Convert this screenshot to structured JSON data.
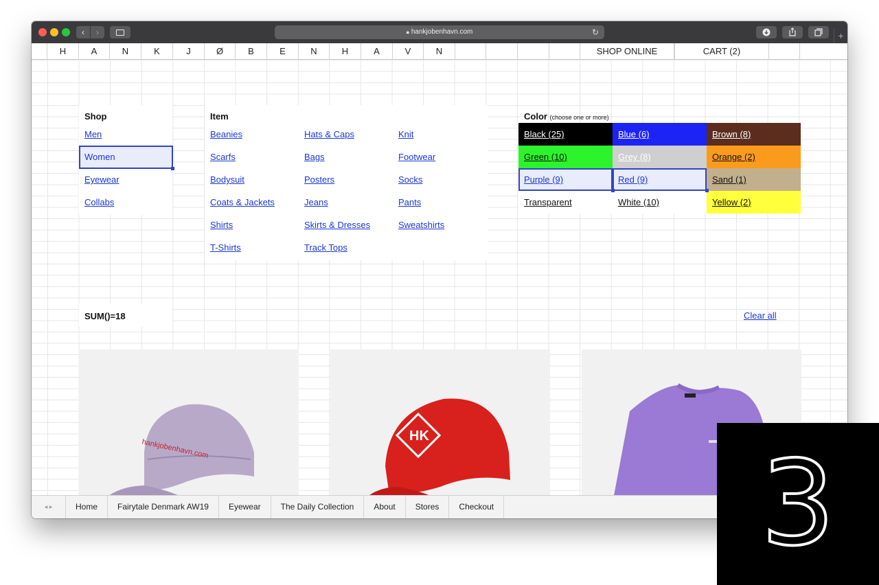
{
  "browser": {
    "url": "hankjobenhavn.com",
    "back_glyph": "‹",
    "forward_glyph": "›",
    "reload_glyph": "↻",
    "new_tab_glyph": "+",
    "icons": [
      "back-icon",
      "forward-icon",
      "sidebar-icon",
      "lock-icon",
      "reload-icon",
      "download-icon",
      "share-icon",
      "tabs-icon"
    ]
  },
  "header": {
    "columns": [
      "",
      "H",
      "A",
      "N",
      "K",
      "J",
      "Ø",
      "B",
      "E",
      "N",
      "H",
      "A",
      "V",
      "N",
      "",
      "",
      "",
      "",
      "SHOP ONLINE",
      "",
      "CART (2)",
      "",
      ""
    ],
    "shop_online": "SHOP ONLINE",
    "cart": "CART (2)"
  },
  "shop": {
    "heading": "Shop",
    "items": [
      "Men",
      "Women",
      "Eyewear",
      "Collabs"
    ],
    "selected": "Women"
  },
  "item": {
    "heading": "Item",
    "col1": [
      "Beanies",
      "Scarfs",
      "Bodysuit",
      "Coats & Jackets",
      "Shirts",
      "T-Shirts"
    ],
    "col2": [
      "Hats & Caps",
      "Bags",
      "Posters",
      "Jeans",
      "Skirts & Dresses",
      "Track Tops"
    ],
    "col3": [
      "Knit",
      "Footwear",
      "Socks",
      "Pants",
      "Sweatshirts"
    ]
  },
  "color": {
    "heading": "Color",
    "hint": "(choose one or more)",
    "options": [
      {
        "label": "Black (25)",
        "bg": "#000000",
        "fg": "#ffffff"
      },
      {
        "label": "Blue (6)",
        "bg": "#1c24f5",
        "fg": "#ffffff"
      },
      {
        "label": "Brown (8)",
        "bg": "#5a2d1e",
        "fg": "#ffffff"
      },
      {
        "label": "Green (10)",
        "bg": "#2cf32c",
        "fg": "#111111"
      },
      {
        "label": "Grey (8)",
        "bg": "#cfcfcf",
        "fg": "#ffffff"
      },
      {
        "label": "Orange (2)",
        "bg": "#fb9b1e",
        "fg": "#111111"
      },
      {
        "label": "Purple (9)",
        "bg": "#e8ecfb",
        "fg": "#1a37d6"
      },
      {
        "label": "Red (9)",
        "bg": "#e8ecfb",
        "fg": "#1a37d6"
      },
      {
        "label": "Sand (1)",
        "bg": "#c2b08c",
        "fg": "#111111"
      },
      {
        "label": "Transparent",
        "bg": "#ffffff",
        "fg": "#111111"
      },
      {
        "label": "White (10)",
        "bg": "#ffffff",
        "fg": "#111111"
      },
      {
        "label": "Yellow (2)",
        "bg": "#ffff3c",
        "fg": "#111111"
      }
    ],
    "selected": [
      "Purple (9)",
      "Red (9)"
    ]
  },
  "summary": {
    "sum": "SUM()=18",
    "clear": "Clear all"
  },
  "products": [
    {
      "name": "Purple cap",
      "print": "hankjobenhavn.com",
      "color": "#b9a9c9"
    },
    {
      "name": "Red cap",
      "logo": "HK",
      "color": "#d8201c"
    },
    {
      "name": "Purple sweatshirt",
      "color": "#9a7ad4"
    }
  ],
  "tabs": [
    "Home",
    "Fairytale Denmark AW19",
    "Eyewear",
    "The Daily Collection",
    "About",
    "Stores",
    "Checkout"
  ],
  "tab_arrows": "◂ ▸",
  "badge": "3"
}
